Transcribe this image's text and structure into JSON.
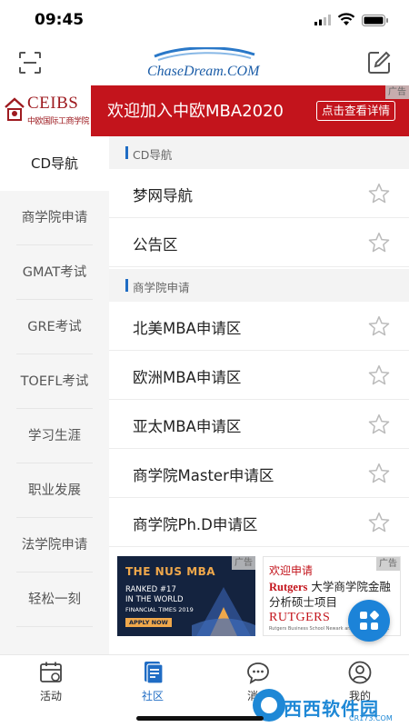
{
  "status_bar": {
    "time": "09:45"
  },
  "header": {
    "logo_text": "ChaseDream.COM"
  },
  "top_ad": {
    "brand": "CEIBS",
    "brand_cn": "中欧国际工商学院",
    "title": "欢迎加入中欧MBA2020",
    "button": "点击查看详情",
    "tag": "广告"
  },
  "sidebar": {
    "items": [
      {
        "label": "CD导航",
        "active": true
      },
      {
        "label": "商学院申请"
      },
      {
        "label": "GMAT考试"
      },
      {
        "label": "GRE考试"
      },
      {
        "label": "TOEFL考试"
      },
      {
        "label": "学习生涯"
      },
      {
        "label": "职业发展"
      },
      {
        "label": "法学院申请"
      },
      {
        "label": "轻松一刻"
      }
    ]
  },
  "sections": [
    {
      "title": "CD导航",
      "items": [
        "梦网导航",
        "公告区"
      ]
    },
    {
      "title": "商学院申请",
      "items": [
        "北美MBA申请区",
        "欧洲MBA申请区",
        "亚太MBA申请区",
        "商学院Master申请区",
        "商学院Ph.D申请区"
      ]
    }
  ],
  "ads": {
    "nus": {
      "tag": "广告",
      "title": "THE NUS MBA",
      "line1": "RANKED #17",
      "line2": "IN THE WORLD",
      "line3": "FINANCIAL TIMES 2019",
      "cta": "APPLY NOW"
    },
    "rutgers": {
      "tag": "广告",
      "top": "欢迎申请",
      "brand": "Rutgers",
      "line1_rest": " 大学商学院金融",
      "line2": "分析硕士项目",
      "logo": "RUTGERS",
      "small": "Rutgers Business School Newark and New Brunswick"
    }
  },
  "tabbar": {
    "tabs": [
      {
        "label": "活动",
        "icon": "calendar-icon"
      },
      {
        "label": "社区",
        "icon": "document-icon",
        "active": true
      },
      {
        "label": "消息",
        "icon": "chat-icon"
      },
      {
        "label": "我的",
        "icon": "user-icon"
      }
    ]
  },
  "watermark": {
    "text": "西西软件园",
    "sub": "CR173.COM"
  },
  "colors": {
    "accent": "#1f6cc4",
    "banner_red": "#c3141c",
    "fab_blue": "#1c83d8"
  }
}
